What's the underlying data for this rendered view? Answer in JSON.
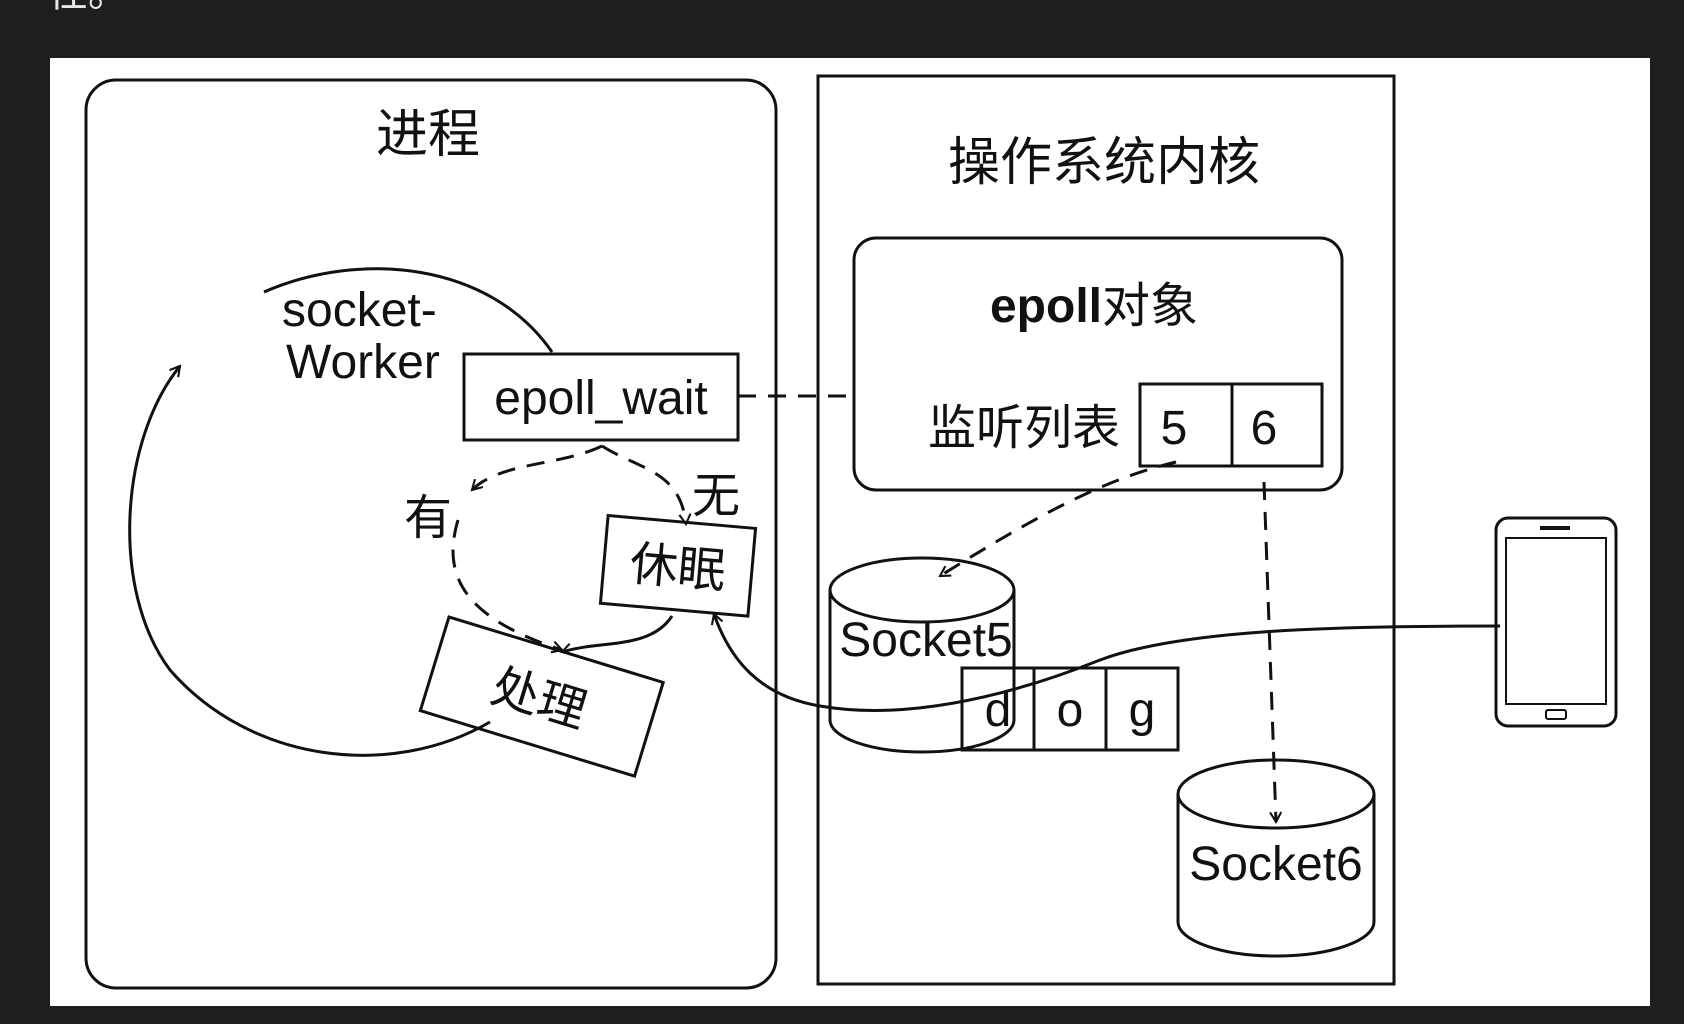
{
  "header_fragment": "任。",
  "process_panel": {
    "title": "进程",
    "worker_label_line1": "socket-",
    "worker_label_line2": "Worker",
    "epoll_wait": "epoll_wait",
    "branch_yes": "有",
    "branch_no": "无",
    "sleep": "休眠",
    "handle": "处理"
  },
  "kernel_panel": {
    "title": "操作系统内核",
    "epoll_bold": "epoll",
    "epoll_suffix": "对象",
    "watch_list_label": "监听列表",
    "watch_list": [
      "5",
      "6"
    ],
    "socket5": "Socket5",
    "socket6": "Socket6",
    "buffer": [
      "d",
      "o",
      "g"
    ]
  },
  "device": "phone-icon",
  "colors": {
    "background": "#1e1e1e",
    "canvas": "#ffffff",
    "gray_fill": "#9d9d9d",
    "ink": "#111111"
  }
}
